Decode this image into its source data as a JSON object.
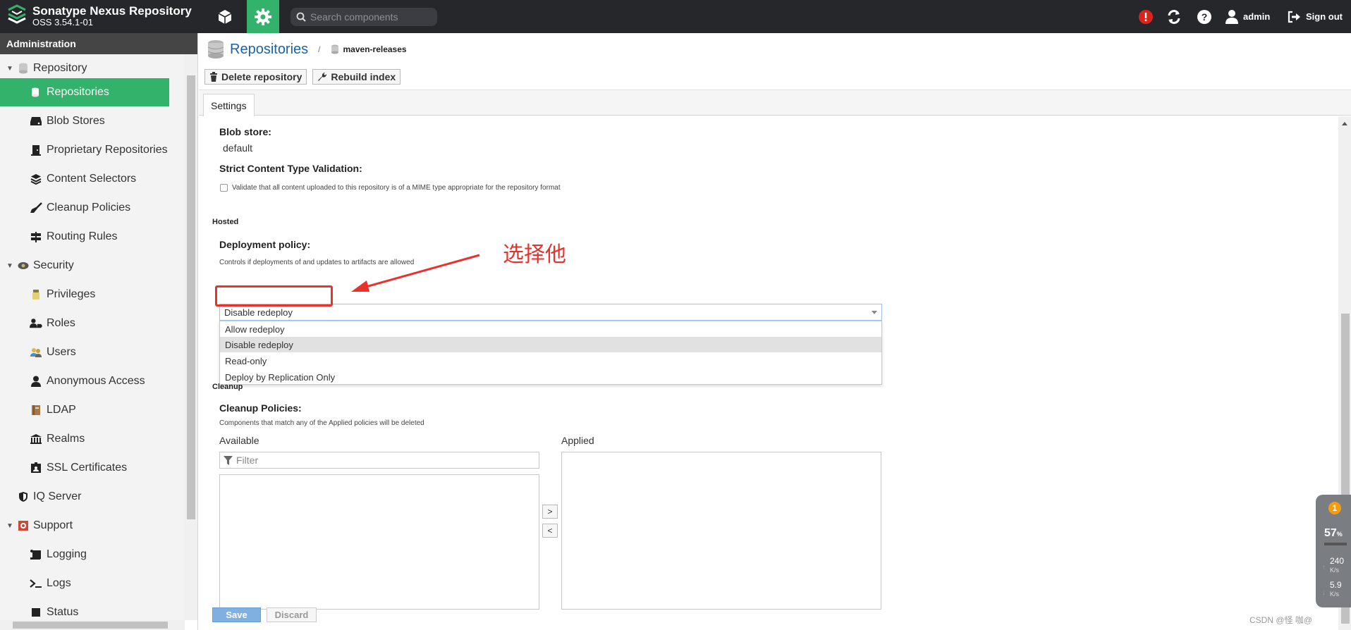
{
  "app": {
    "title": "Sonatype Nexus Repository",
    "version": "OSS 3.54.1-01"
  },
  "topbar": {
    "search_placeholder": "Search components",
    "user": "admin",
    "signout": "Sign out"
  },
  "sidebar": {
    "header": "Administration",
    "items": [
      {
        "label": "Repository",
        "icon": "database-icon",
        "group": true
      },
      {
        "label": "Repositories",
        "icon": "database-icon",
        "active": true
      },
      {
        "label": "Blob Stores",
        "icon": "hdd-icon"
      },
      {
        "label": "Proprietary Repositories",
        "icon": "door-icon"
      },
      {
        "label": "Content Selectors",
        "icon": "layers-icon"
      },
      {
        "label": "Cleanup Policies",
        "icon": "broom-icon"
      },
      {
        "label": "Routing Rules",
        "icon": "signpost-icon"
      },
      {
        "label": "Security",
        "icon": "eye-icon",
        "group": true
      },
      {
        "label": "Privileges",
        "icon": "medal-icon"
      },
      {
        "label": "Roles",
        "icon": "user-tag-icon"
      },
      {
        "label": "Users",
        "icon": "users-icon"
      },
      {
        "label": "Anonymous Access",
        "icon": "user-icon"
      },
      {
        "label": "LDAP",
        "icon": "book-icon"
      },
      {
        "label": "Realms",
        "icon": "realms-icon"
      },
      {
        "label": "SSL Certificates",
        "icon": "id-card-icon"
      },
      {
        "label": "IQ Server",
        "icon": "shield-icon"
      },
      {
        "label": "Support",
        "icon": "support-icon",
        "group": true
      },
      {
        "label": "Logging",
        "icon": "scroll-icon"
      },
      {
        "label": "Logs",
        "icon": "terminal-icon"
      },
      {
        "label": "Status",
        "icon": "status-icon"
      }
    ]
  },
  "breadcrumb": {
    "title": "Repositories",
    "separator": "/",
    "current": "maven-releases"
  },
  "toolbar": {
    "delete_label": "Delete repository",
    "rebuild_label": "Rebuild index"
  },
  "tabs": {
    "settings": "Settings"
  },
  "form": {
    "blob_store_label": "Blob store:",
    "blob_store_value": "default",
    "strict_label": "Strict Content Type Validation:",
    "strict_desc": "Validate that all content uploaded to this repository is of a MIME type appropriate for the repository format",
    "hosted_section": "Hosted",
    "deployment_label": "Deployment policy:",
    "deployment_desc": "Controls if deployments of and updates to artifacts are allowed",
    "deployment_value": "Disable redeploy",
    "deployment_options": [
      "Allow redeploy",
      "Disable redeploy",
      "Read-only",
      "Deploy by Replication Only"
    ],
    "cleanup_section": "Cleanup",
    "cleanup_label": "Cleanup Policies:",
    "cleanup_desc": "Components that match any of the Applied policies will be deleted",
    "available_label": "Available",
    "applied_label": "Applied",
    "filter_placeholder": "Filter",
    "move_right": ">",
    "move_left": "<",
    "save_label": "Save",
    "discard_label": "Discard"
  },
  "annotation": {
    "text": "选择他",
    "color": "#e8322b"
  },
  "widget": {
    "badge": "1",
    "percent": "57",
    "percent_unit": "%",
    "upload": "240",
    "upload_unit": "K/s",
    "download": "5.9",
    "download_unit": "K/s"
  },
  "watermark": "CSDN @怪 咖@",
  "colors": {
    "topbar": "#26272b",
    "accent_green": "#33b26b",
    "link_blue": "#1a63a8",
    "alert_red": "#d9251d"
  }
}
